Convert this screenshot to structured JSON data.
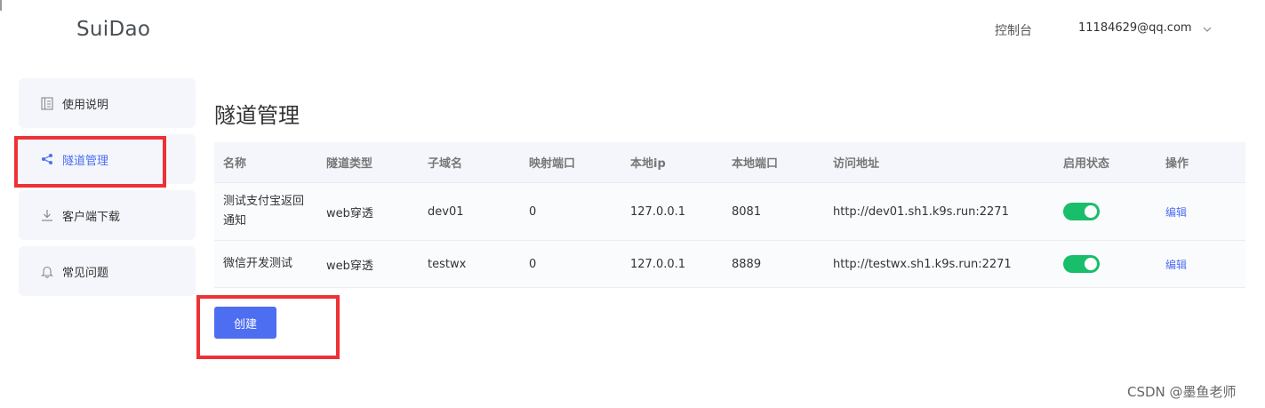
{
  "header": {
    "logo": "SuiDao",
    "console_link": "控制台",
    "user_email": "11184629@qq.com"
  },
  "sidebar": {
    "items": [
      {
        "label": "使用说明",
        "icon": "document-icon",
        "active": false
      },
      {
        "label": "隧道管理",
        "icon": "share-icon",
        "active": true
      },
      {
        "label": "客户端下载",
        "icon": "download-icon",
        "active": false
      },
      {
        "label": "常见问题",
        "icon": "bell-icon",
        "active": false
      }
    ]
  },
  "main": {
    "title": "隧道管理",
    "columns": [
      "名称",
      "隧道类型",
      "子域名",
      "映射端口",
      "本地ip",
      "本地端口",
      "访问地址",
      "启用状态",
      "操作"
    ],
    "rows": [
      {
        "name": "测试支付宝返回通知",
        "type": "web穿透",
        "subdomain": "dev01",
        "port": "0",
        "local_ip": "127.0.0.1",
        "local_port": "8081",
        "url": "http://dev01.sh1.k9s.run:2271",
        "enabled": true,
        "action": "编辑"
      },
      {
        "name": "微信开发测试",
        "type": "web穿透",
        "subdomain": "testwx",
        "port": "0",
        "local_ip": "127.0.0.1",
        "local_port": "8889",
        "url": "http://testwx.sh1.k9s.run:2271",
        "enabled": true,
        "action": "编辑"
      }
    ],
    "create_button": "创建"
  },
  "colors": {
    "accent": "#4e6ef2",
    "toggle_on": "#19be6b",
    "annotation": "#ee3037"
  },
  "watermark": "CSDN @墨鱼老师"
}
